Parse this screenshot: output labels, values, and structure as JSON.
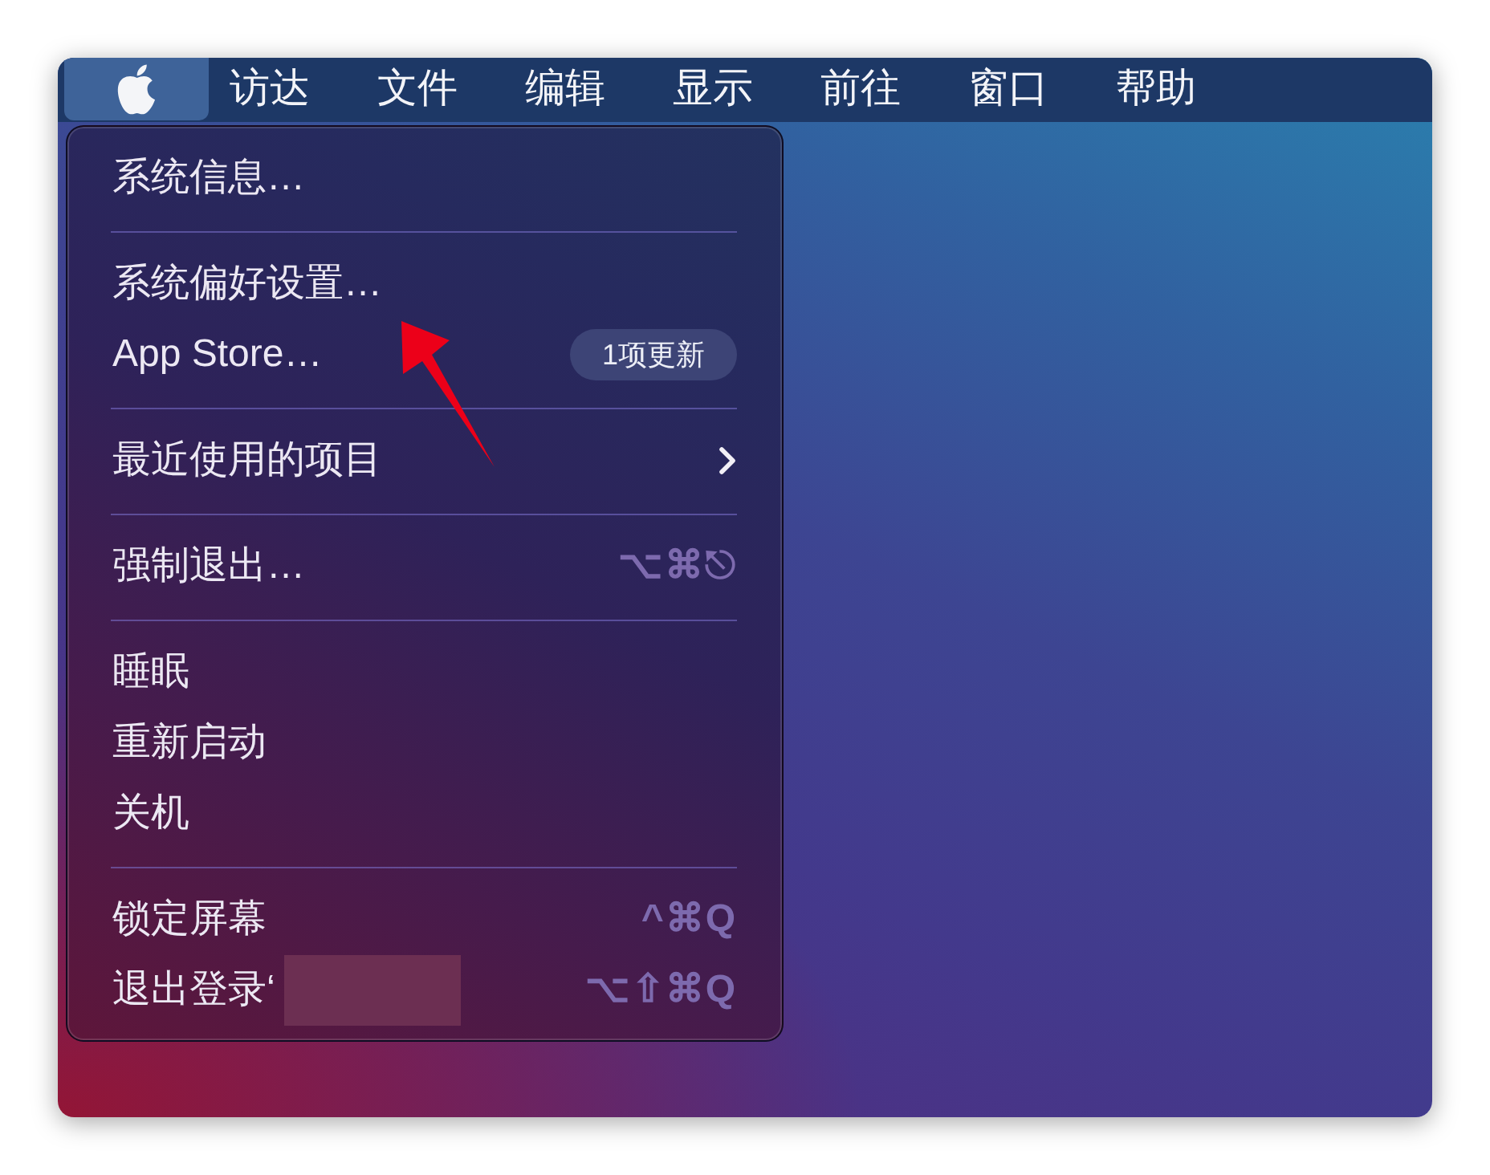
{
  "menu_bar": {
    "items": [
      {
        "kind": "apple",
        "selected": true
      },
      {
        "kind": "title",
        "label": "访达",
        "selected": false
      },
      {
        "kind": "title",
        "label": "文件",
        "selected": false
      },
      {
        "kind": "title",
        "label": "编辑",
        "selected": false
      },
      {
        "kind": "title",
        "label": "显示",
        "selected": false
      },
      {
        "kind": "title",
        "label": "前往",
        "selected": false
      },
      {
        "kind": "title",
        "label": "窗口",
        "selected": false
      },
      {
        "kind": "title",
        "label": "帮助",
        "selected": false
      }
    ]
  },
  "menu": {
    "items": [
      {
        "kind": "item",
        "label": "系统信息…"
      },
      {
        "kind": "separator"
      },
      {
        "kind": "item",
        "label": "系统偏好设置…"
      },
      {
        "kind": "item",
        "label": "App Store…",
        "badge": "1项更新"
      },
      {
        "kind": "separator"
      },
      {
        "kind": "submenu",
        "label": "最近使用的项目"
      },
      {
        "kind": "separator"
      },
      {
        "kind": "item",
        "label": "强制退出…",
        "shortcut": "⌥⌘⎋"
      },
      {
        "kind": "separator"
      },
      {
        "kind": "item",
        "label": "睡眠"
      },
      {
        "kind": "item",
        "label": "重新启动"
      },
      {
        "kind": "item",
        "label": "关机"
      },
      {
        "kind": "separator"
      },
      {
        "kind": "item",
        "label": "锁定屏幕",
        "shortcut": "^⌘Q"
      },
      {
        "kind": "item",
        "label": "退出登录‘",
        "shortcut": "⌥⇧⌘Q",
        "redacted": true
      }
    ]
  },
  "annotation": {
    "kind": "arrow"
  }
}
